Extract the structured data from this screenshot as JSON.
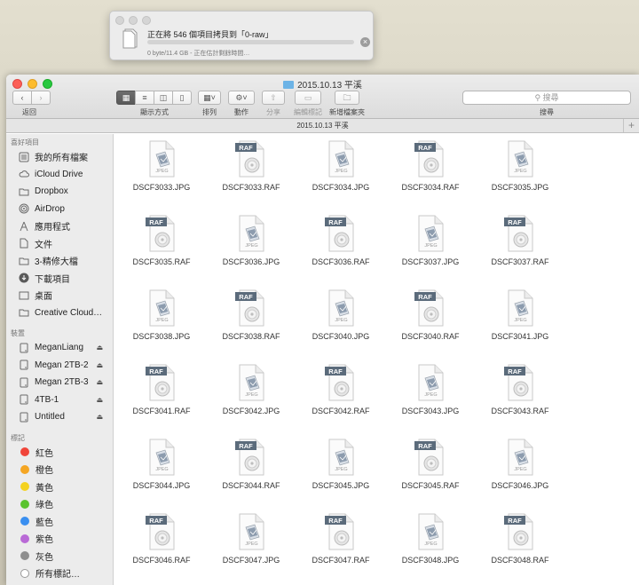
{
  "copy_dialog": {
    "title": "正在將 546 個項目拷貝到「0-raw」",
    "status": "0 byte/11.4 GB - 正在估計剩餘時間…",
    "progress": 0
  },
  "window": {
    "title": "2015.10.13 平溪",
    "path_title": "2015.10.13 平溪"
  },
  "toolbar": {
    "back_label": "返回",
    "view_label": "顯示方式",
    "arrange_label": "排列",
    "action_label": "動作",
    "share_label": "分享",
    "tags_label": "編輯標記",
    "new_folder_label": "新增檔案夾",
    "search_label": "搜尋",
    "search_placeholder": "搜尋"
  },
  "sidebar": {
    "favorites_header": "喜好項目",
    "favorites": [
      {
        "label": "我的所有檔案",
        "icon": "all-files-icon"
      },
      {
        "label": "iCloud Drive",
        "icon": "cloud-icon"
      },
      {
        "label": "Dropbox",
        "icon": "folder-icon"
      },
      {
        "label": "AirDrop",
        "icon": "airdrop-icon"
      },
      {
        "label": "應用程式",
        "icon": "applications-icon"
      },
      {
        "label": "文件",
        "icon": "document-icon"
      },
      {
        "label": "3-精修大檔",
        "icon": "folder-icon"
      },
      {
        "label": "下載項目",
        "icon": "download-icon"
      },
      {
        "label": "桌面",
        "icon": "desktop-icon"
      },
      {
        "label": "Creative Cloud…",
        "icon": "folder-icon"
      }
    ],
    "devices_header": "裝置",
    "devices": [
      {
        "label": "MeganLiang",
        "eject": true
      },
      {
        "label": "Megan 2TB-2",
        "eject": true
      },
      {
        "label": "Megan 2TB-3",
        "eject": true
      },
      {
        "label": "4TB-1",
        "eject": true
      },
      {
        "label": "Untitled",
        "eject": true
      }
    ],
    "tags_header": "標記",
    "tags": [
      {
        "label": "紅色",
        "color": "#f0453a"
      },
      {
        "label": "橙色",
        "color": "#f5a623"
      },
      {
        "label": "黃色",
        "color": "#f4d21f"
      },
      {
        "label": "綠色",
        "color": "#5ac32f"
      },
      {
        "label": "藍色",
        "color": "#3a8ff0"
      },
      {
        "label": "紫色",
        "color": "#b96ad6"
      },
      {
        "label": "灰色",
        "color": "#8e8e8e"
      }
    ],
    "all_tags_label": "所有標記…"
  },
  "files": [
    {
      "name": "DSCF3033.JPG",
      "type": "jpeg"
    },
    {
      "name": "DSCF3033.RAF",
      "type": "raf"
    },
    {
      "name": "DSCF3034.JPG",
      "type": "jpeg"
    },
    {
      "name": "DSCF3034.RAF",
      "type": "raf"
    },
    {
      "name": "DSCF3035.JPG",
      "type": "jpeg"
    },
    {
      "name": "DSCF3035.RAF",
      "type": "raf"
    },
    {
      "name": "DSCF3036.JPG",
      "type": "jpeg"
    },
    {
      "name": "DSCF3036.RAF",
      "type": "raf"
    },
    {
      "name": "DSCF3037.JPG",
      "type": "jpeg"
    },
    {
      "name": "DSCF3037.RAF",
      "type": "raf"
    },
    {
      "name": "DSCF3038.JPG",
      "type": "jpeg"
    },
    {
      "name": "DSCF3038.RAF",
      "type": "raf"
    },
    {
      "name": "DSCF3040.JPG",
      "type": "jpeg"
    },
    {
      "name": "DSCF3040.RAF",
      "type": "raf"
    },
    {
      "name": "DSCF3041.JPG",
      "type": "jpeg"
    },
    {
      "name": "DSCF3041.RAF",
      "type": "raf"
    },
    {
      "name": "DSCF3042.JPG",
      "type": "jpeg"
    },
    {
      "name": "DSCF3042.RAF",
      "type": "raf"
    },
    {
      "name": "DSCF3043.JPG",
      "type": "jpeg"
    },
    {
      "name": "DSCF3043.RAF",
      "type": "raf"
    },
    {
      "name": "DSCF3044.JPG",
      "type": "jpeg"
    },
    {
      "name": "DSCF3044.RAF",
      "type": "raf"
    },
    {
      "name": "DSCF3045.JPG",
      "type": "jpeg"
    },
    {
      "name": "DSCF3045.RAF",
      "type": "raf"
    },
    {
      "name": "DSCF3046.JPG",
      "type": "jpeg"
    },
    {
      "name": "DSCF3046.RAF",
      "type": "raf"
    },
    {
      "name": "DSCF3047.JPG",
      "type": "jpeg"
    },
    {
      "name": "DSCF3047.RAF",
      "type": "raf"
    },
    {
      "name": "DSCF3048.JPG",
      "type": "jpeg"
    },
    {
      "name": "DSCF3048.RAF",
      "type": "raf"
    }
  ],
  "file_badges": {
    "jpeg": "JPEG",
    "raf": "RAF"
  }
}
